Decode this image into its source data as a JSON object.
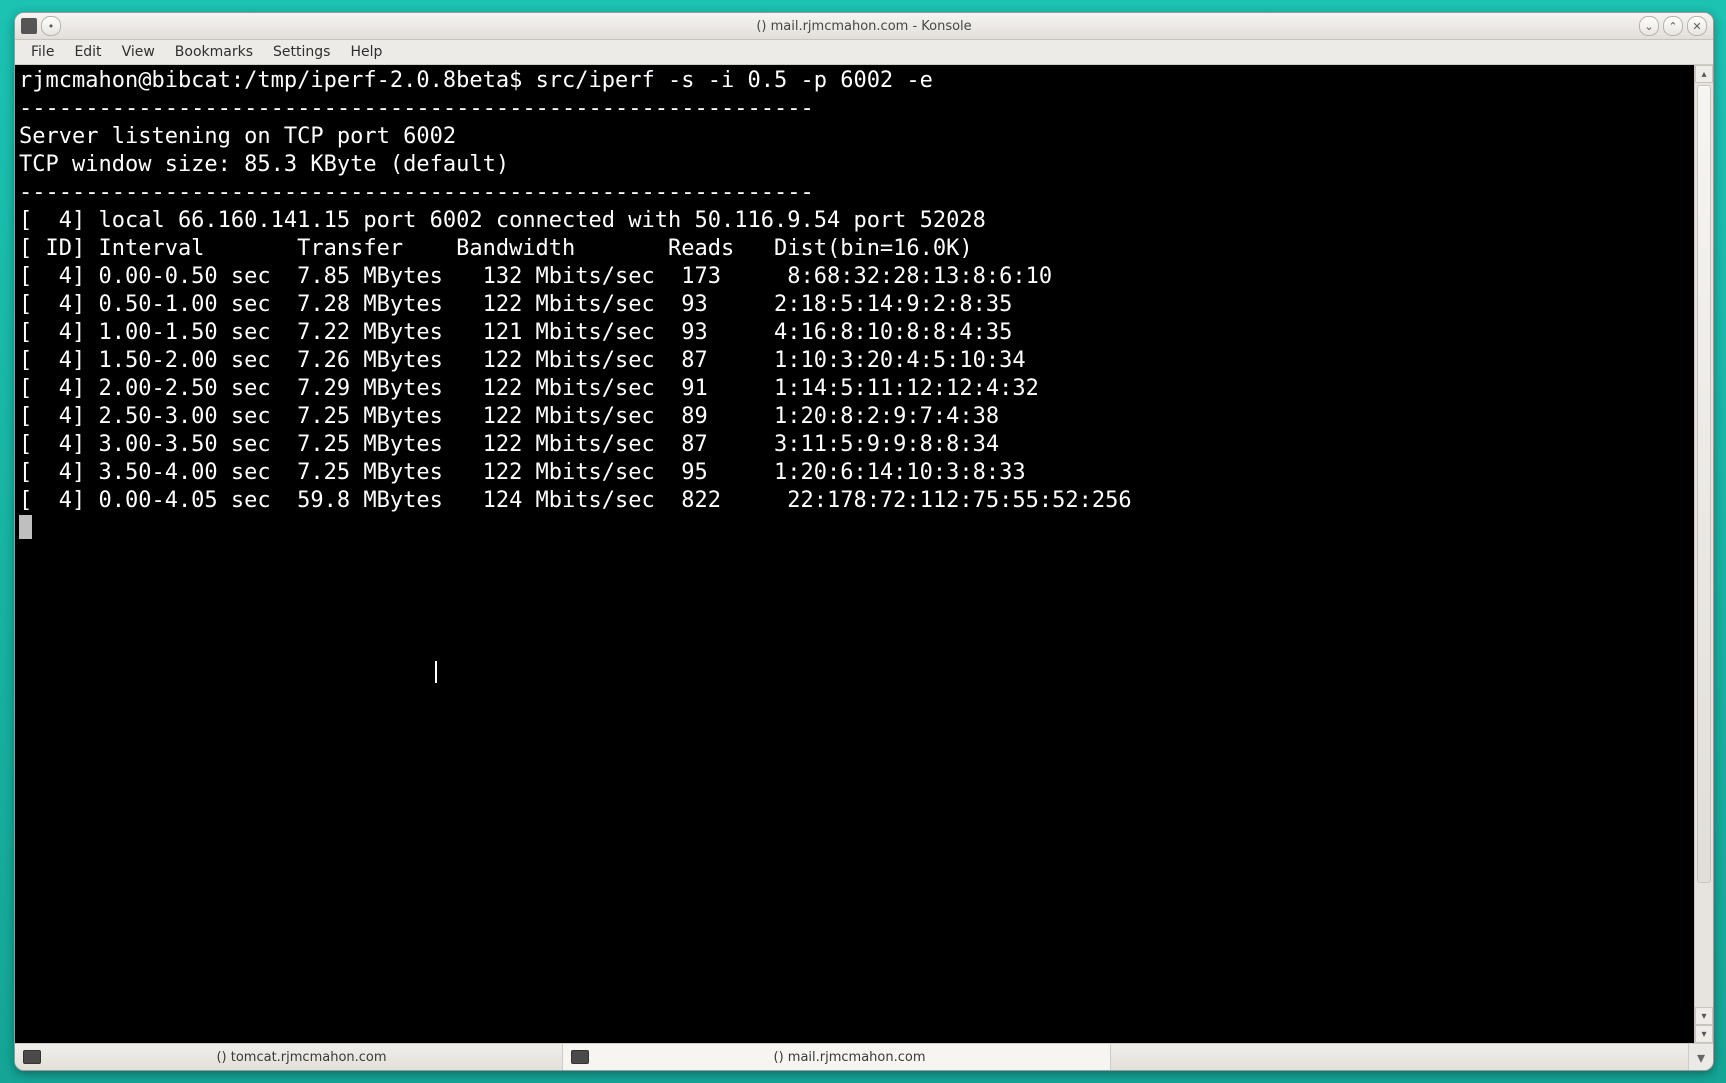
{
  "window": {
    "title": "() mail.rjmcmahon.com - Konsole"
  },
  "menubar": {
    "items": [
      "File",
      "Edit",
      "View",
      "Bookmarks",
      "Settings",
      "Help"
    ]
  },
  "terminal": {
    "prompt": "rjmcmahon@bibcat:/tmp/iperf-2.0.8beta$ ",
    "command": "src/iperf -s -i 0.5 -p 6002 -e",
    "sep": "------------------------------------------------------------",
    "server_line": "Server listening on TCP port 6002",
    "tcp_line": "TCP window size: 85.3 KByte (default)",
    "conn_line": "[  4] local 66.160.141.15 port 6002 connected with 50.116.9.54 port 52028",
    "header": "[ ID] Interval       Transfer    Bandwidth       Reads   Dist(bin=16.0K)",
    "rows": [
      "[  4] 0.00-0.50 sec  7.85 MBytes   132 Mbits/sec  173     8:68:32:28:13:8:6:10",
      "[  4] 0.50-1.00 sec  7.28 MBytes   122 Mbits/sec  93     2:18:5:14:9:2:8:35",
      "[  4] 1.00-1.50 sec  7.22 MBytes   121 Mbits/sec  93     4:16:8:10:8:8:4:35",
      "[  4] 1.50-2.00 sec  7.26 MBytes   122 Mbits/sec  87     1:10:3:20:4:5:10:34",
      "[  4] 2.00-2.50 sec  7.29 MBytes   122 Mbits/sec  91     1:14:5:11:12:12:4:32",
      "[  4] 2.50-3.00 sec  7.25 MBytes   122 Mbits/sec  89     1:20:8:2:9:7:4:38",
      "[  4] 3.00-3.50 sec  7.25 MBytes   122 Mbits/sec  87     3:11:5:9:9:8:8:34",
      "[  4] 3.50-4.00 sec  7.25 MBytes   122 Mbits/sec  95     1:20:6:14:10:3:8:33",
      "[  4] 0.00-4.05 sec  59.8 MBytes   124 Mbits/sec  822     22:178:72:112:75:55:52:256"
    ]
  },
  "tabs": {
    "items": [
      {
        "label": "() tomcat.rjmcmahon.com",
        "active": false
      },
      {
        "label": "() mail.rjmcmahon.com",
        "active": true
      }
    ]
  },
  "icons": {
    "minimize": "⌄",
    "maximize": "⌃",
    "close": "✕",
    "arrow_up": "▴",
    "arrow_down": "▾"
  }
}
